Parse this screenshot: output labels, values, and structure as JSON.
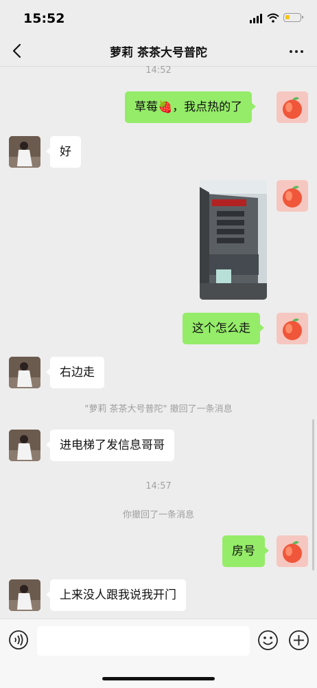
{
  "status_bar": {
    "time": "15:52"
  },
  "nav": {
    "title": "萝莉 茶茶大号普陀"
  },
  "messages": {
    "ts1": "14:52",
    "m1": "草莓🍓，我点热的了",
    "m2": "好",
    "m4": "这个怎么走",
    "m5": "右边走",
    "sys1": "\"萝莉 茶茶大号普陀\" 撤回了一条消息",
    "m6": "进电梯了发信息哥哥",
    "ts2": "14:57",
    "sys2": "你撤回了一条消息",
    "m7": "房号",
    "m8": "上来没人跟我说我开门"
  },
  "input": {
    "value": "",
    "placeholder": ""
  },
  "icons": {
    "back": "chevron-left-icon",
    "more": "more-dots-icon",
    "voice": "voice-icon",
    "emoji": "emoji-icon",
    "plus": "plus-icon"
  },
  "colors": {
    "self_bubble": "#95ec69",
    "other_bubble": "#ffffff",
    "background": "#ededed"
  }
}
